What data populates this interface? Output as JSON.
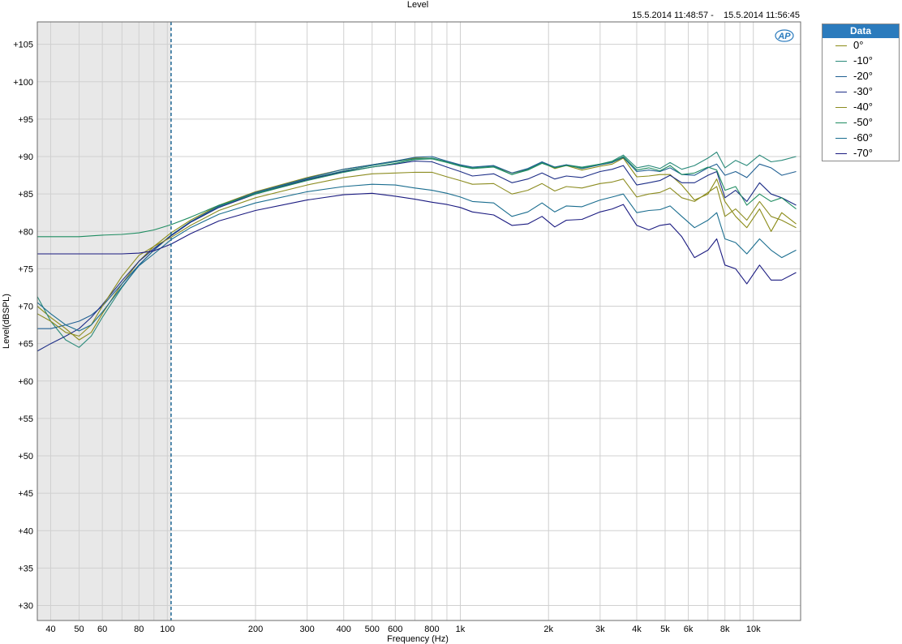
{
  "header": {
    "title": "Level",
    "timestamp": "15.5.2014 11:48:57 -    15.5.2014 11:56:45"
  },
  "logo_text": "AP",
  "legend": {
    "title": "Data",
    "items": [
      {
        "label": "0°",
        "color": "#8b8b16"
      },
      {
        "label": "-10°",
        "color": "#2a8a7a"
      },
      {
        "label": "-20°",
        "color": "#1f5f92"
      },
      {
        "label": "-30°",
        "color": "#1c2d86"
      },
      {
        "label": "-40°",
        "color": "#8c8c20"
      },
      {
        "label": "-50°",
        "color": "#1e8c60"
      },
      {
        "label": "-60°",
        "color": "#1a6d8f"
      },
      {
        "label": "-70°",
        "color": "#1a1a80"
      }
    ]
  },
  "chart_data": {
    "type": "line",
    "title": "Level",
    "xlabel": "Frequency (Hz)",
    "ylabel": "Level(dBSPL)",
    "x_scale": "log",
    "xlim": [
      36,
      14500
    ],
    "ylim": [
      28,
      108
    ],
    "grid": true,
    "legend_position": "right",
    "x_ticks": [
      {
        "value": 40,
        "label": "40"
      },
      {
        "value": 50,
        "label": "50"
      },
      {
        "value": 60,
        "label": "60"
      },
      {
        "value": 80,
        "label": "80"
      },
      {
        "value": 100,
        "label": "100"
      },
      {
        "value": 200,
        "label": "200"
      },
      {
        "value": 300,
        "label": "300"
      },
      {
        "value": 400,
        "label": "400"
      },
      {
        "value": 500,
        "label": "500"
      },
      {
        "value": 600,
        "label": "600"
      },
      {
        "value": 800,
        "label": "800"
      },
      {
        "value": 1000,
        "label": "1k"
      },
      {
        "value": 2000,
        "label": "2k"
      },
      {
        "value": 3000,
        "label": "3k"
      },
      {
        "value": 4000,
        "label": "4k"
      },
      {
        "value": 5000,
        "label": "5k"
      },
      {
        "value": 6000,
        "label": "6k"
      },
      {
        "value": 8000,
        "label": "8k"
      },
      {
        "value": 10000,
        "label": "10k"
      }
    ],
    "y_ticks": [
      {
        "value": 30,
        "label": "+30"
      },
      {
        "value": 35,
        "label": "+35"
      },
      {
        "value": 40,
        "label": "+40"
      },
      {
        "value": 45,
        "label": "+45"
      },
      {
        "value": 50,
        "label": "+50"
      },
      {
        "value": 55,
        "label": "+55"
      },
      {
        "value": 60,
        "label": "+60"
      },
      {
        "value": 65,
        "label": "+65"
      },
      {
        "value": 70,
        "label": "+70"
      },
      {
        "value": 75,
        "label": "+75"
      },
      {
        "value": 80,
        "label": "+80"
      },
      {
        "value": 85,
        "label": "+85"
      },
      {
        "value": 90,
        "label": "+90"
      },
      {
        "value": 95,
        "label": "+95"
      },
      {
        "value": 100,
        "label": "+100"
      },
      {
        "value": 105,
        "label": "+105"
      }
    ],
    "shaded_region": {
      "x_from": 36,
      "x_to": 103
    },
    "marker_x": 103,
    "x": [
      36,
      40,
      45,
      50,
      55,
      60,
      70,
      80,
      90,
      103,
      120,
      150,
      200,
      300,
      400,
      500,
      600,
      700,
      800,
      900,
      1000,
      1100,
      1300,
      1500,
      1700,
      1900,
      2100,
      2300,
      2600,
      3000,
      3300,
      3600,
      4000,
      4400,
      4800,
      5200,
      5700,
      6300,
      7000,
      7500,
      8000,
      8700,
      9500,
      10500,
      11500,
      12500,
      14000
    ],
    "series": [
      {
        "name": "0°",
        "color": "#8b8b16",
        "values": [
          70.0,
          68.5,
          67.0,
          65.5,
          66.5,
          69.0,
          73.0,
          76.0,
          78.0,
          79.8,
          81.5,
          83.5,
          85.3,
          87.2,
          88.3,
          88.9,
          89.4,
          89.8,
          89.8,
          89.3,
          88.8,
          88.5,
          88.7,
          87.8,
          88.3,
          89.2,
          88.4,
          88.8,
          88.2,
          88.7,
          89.0,
          89.8,
          87.3,
          87.4,
          87.6,
          87.6,
          86.2,
          84.2,
          85.0,
          87.0,
          84.0,
          82.0,
          80.5,
          83.0,
          80.0,
          82.5,
          81.0
        ]
      },
      {
        "name": "-10°",
        "color": "#2a8a7a",
        "values": [
          71.3,
          68.0,
          65.5,
          64.5,
          66.0,
          68.5,
          72.5,
          75.5,
          77.5,
          79.5,
          81.3,
          83.3,
          85.1,
          87.0,
          88.1,
          88.8,
          89.3,
          89.7,
          89.8,
          89.3,
          88.8,
          88.5,
          88.7,
          87.6,
          88.3,
          89.2,
          88.6,
          88.9,
          88.6,
          89.0,
          89.4,
          90.2,
          88.5,
          88.8,
          88.4,
          89.2,
          88.3,
          88.8,
          89.8,
          90.6,
          88.5,
          89.5,
          88.8,
          90.2,
          89.3,
          89.5,
          90.0
        ]
      },
      {
        "name": "-20°",
        "color": "#1f5f92",
        "values": [
          67.0,
          67.0,
          67.5,
          68.0,
          68.8,
          70.0,
          73.0,
          75.5,
          77.5,
          79.5,
          81.3,
          83.4,
          85.2,
          87.1,
          88.3,
          88.9,
          89.4,
          89.9,
          90.0,
          89.4,
          88.9,
          88.6,
          88.8,
          87.8,
          88.4,
          89.3,
          88.6,
          88.9,
          88.4,
          88.9,
          89.2,
          89.9,
          88.0,
          88.2,
          88.0,
          88.5,
          87.6,
          87.5,
          88.5,
          89.0,
          87.5,
          88.0,
          87.2,
          89.0,
          88.5,
          87.5,
          88.0
        ]
      },
      {
        "name": "-30°",
        "color": "#1c2d86",
        "values": [
          64.0,
          65.0,
          66.0,
          67.0,
          68.5,
          70.2,
          73.4,
          76.0,
          77.7,
          79.4,
          81.2,
          83.2,
          85.0,
          86.9,
          88.0,
          88.6,
          89.0,
          89.4,
          89.3,
          88.6,
          88.0,
          87.4,
          87.7,
          86.5,
          87.0,
          87.8,
          87.0,
          87.4,
          87.2,
          88.0,
          88.3,
          88.8,
          86.2,
          86.5,
          86.8,
          87.5,
          86.5,
          86.5,
          87.5,
          88.0,
          84.5,
          85.5,
          84.0,
          86.5,
          85.0,
          84.5,
          83.5
        ]
      },
      {
        "name": "-40°",
        "color": "#8c8c20",
        "values": [
          69.0,
          68.0,
          66.5,
          66.0,
          67.5,
          70.0,
          74.0,
          76.8,
          78.0,
          79.2,
          80.8,
          82.8,
          84.5,
          86.2,
          87.2,
          87.7,
          87.8,
          87.9,
          87.9,
          87.3,
          86.8,
          86.3,
          86.4,
          85.0,
          85.5,
          86.4,
          85.4,
          86.0,
          85.8,
          86.4,
          86.6,
          87.0,
          84.6,
          85.0,
          85.2,
          85.8,
          84.5,
          84.0,
          85.2,
          86.0,
          82.0,
          83.0,
          81.5,
          84.0,
          82.0,
          81.5,
          80.5
        ]
      },
      {
        "name": "-50°",
        "color": "#1e8c60",
        "values": [
          79.3,
          79.3,
          79.3,
          79.3,
          79.4,
          79.5,
          79.6,
          79.8,
          80.2,
          80.9,
          81.9,
          83.5,
          85.0,
          86.8,
          87.9,
          88.6,
          89.1,
          89.6,
          89.7,
          89.2,
          88.7,
          88.4,
          88.6,
          87.6,
          88.2,
          89.1,
          88.5,
          88.8,
          88.5,
          89.0,
          89.3,
          90.0,
          88.2,
          88.5,
          88.1,
          88.8,
          87.6,
          87.8,
          88.6,
          88.2,
          85.5,
          86.0,
          83.5,
          85.0,
          84.0,
          84.5,
          83.0
        ]
      },
      {
        "name": "-60°",
        "color": "#1a6d8f",
        "values": [
          70.5,
          69.0,
          67.5,
          66.7,
          67.5,
          69.2,
          72.6,
          75.4,
          77.0,
          78.9,
          80.5,
          82.3,
          83.8,
          85.3,
          86.0,
          86.3,
          86.2,
          85.8,
          85.5,
          85.1,
          84.6,
          84.0,
          83.8,
          82.0,
          82.6,
          83.8,
          82.6,
          83.4,
          83.3,
          84.2,
          84.6,
          85.0,
          82.5,
          82.8,
          82.9,
          83.4,
          82.0,
          80.5,
          81.5,
          82.5,
          79.0,
          78.5,
          77.0,
          79.0,
          77.5,
          76.5,
          77.5
        ]
      },
      {
        "name": "-70°",
        "color": "#1a1a80",
        "values": [
          77.0,
          77.0,
          77.0,
          77.0,
          77.0,
          77.0,
          77.0,
          77.1,
          77.4,
          78.3,
          79.7,
          81.4,
          82.8,
          84.2,
          84.9,
          85.1,
          84.7,
          84.3,
          83.9,
          83.6,
          83.2,
          82.6,
          82.2,
          80.8,
          81.0,
          82.0,
          80.6,
          81.5,
          81.6,
          82.6,
          83.0,
          83.6,
          80.8,
          80.2,
          80.8,
          81.0,
          79.3,
          76.5,
          77.5,
          79.0,
          75.5,
          75.0,
          73.0,
          75.5,
          73.5,
          73.5,
          74.5
        ]
      }
    ]
  }
}
